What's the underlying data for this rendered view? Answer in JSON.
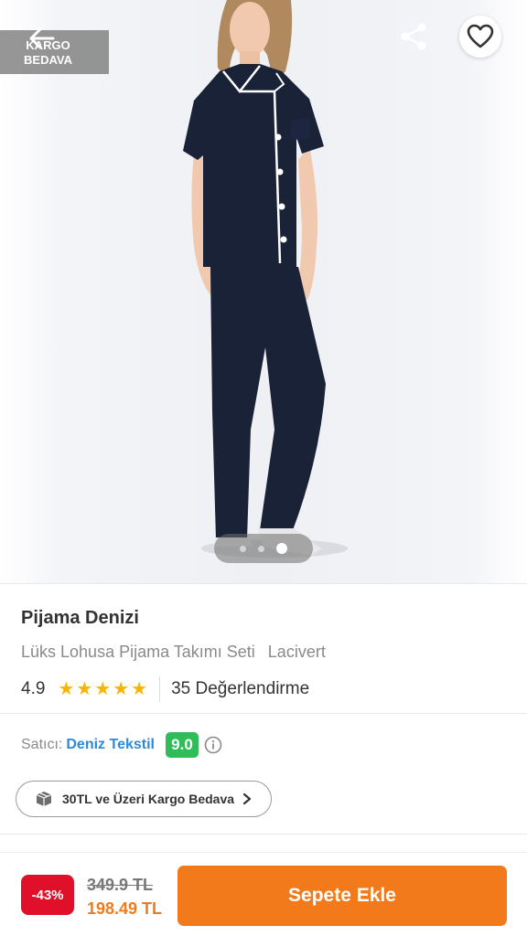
{
  "colors": {
    "accent": "#f27a1a",
    "discount": "#e0102a",
    "seller_link": "#2d8ad9",
    "score_badge": "#2ebd59",
    "star": "#f9b400"
  },
  "gallery": {
    "cargo_badge": "KARGO\nBEDAVA",
    "image_count": 3,
    "active_index": 2,
    "image_alt": "model wearing navy short-sleeve pajama set with white piping"
  },
  "header": {
    "back_icon": "arrow-left-icon",
    "share_icon": "share-icon",
    "favorite_icon": "heart-outline-icon"
  },
  "product": {
    "brand": "Pijama Denizi",
    "name": "Lüks Lohusa Pijama Takımı Seti",
    "variant": "Lacivert",
    "rating": "4.9",
    "stars": 5,
    "review_count": "35 Değerlendirme"
  },
  "seller": {
    "label": "Satıcı:",
    "name": "Deniz Tekstil",
    "score": "9.0",
    "info_icon": "info-circle-icon"
  },
  "shipping": {
    "icon": "package-box-icon",
    "text": "30TL ve Üzeri Kargo Bedava",
    "chevron": "chevron-right-icon"
  },
  "purchase": {
    "discount": "-43%",
    "old_price": "349.9 TL",
    "new_price": "198.49 TL",
    "button_label": "Sepete Ekle"
  }
}
